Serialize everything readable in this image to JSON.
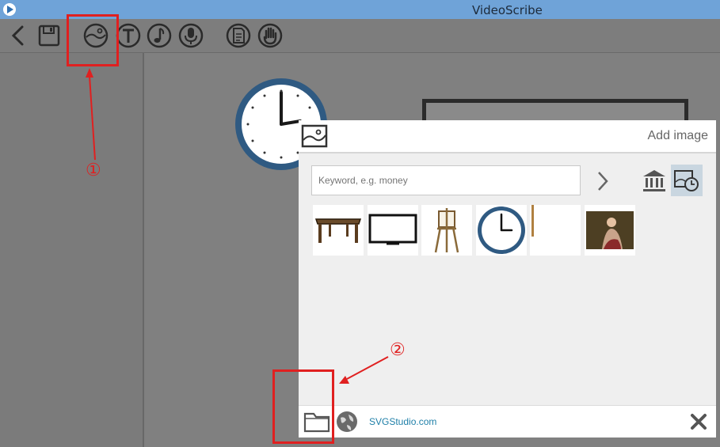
{
  "window": {
    "title": "VideoScribe"
  },
  "toolbar": {
    "buttons": [
      {
        "name": "back-icon"
      },
      {
        "name": "save-icon"
      },
      {
        "name": "image-icon"
      },
      {
        "name": "text-icon"
      },
      {
        "name": "music-icon"
      },
      {
        "name": "microphone-icon"
      },
      {
        "name": "document-icon"
      },
      {
        "name": "hand-icon"
      }
    ]
  },
  "add_image_panel": {
    "title": "Add image",
    "search": {
      "value": "",
      "placeholder": "Keyword, e.g. money"
    },
    "thumbnails": [
      {
        "name": "table-thumbnail"
      },
      {
        "name": "monitor-thumbnail"
      },
      {
        "name": "easel-thumbnail"
      },
      {
        "name": "clock-thumbnail"
      },
      {
        "name": "stick-thumbnail"
      },
      {
        "name": "painting-thumbnail"
      }
    ],
    "footer": {
      "link_text": "SVGStudio.com"
    }
  },
  "annotations": {
    "label_1": "①",
    "label_2": "②"
  },
  "colors": {
    "titlebar": "#6fa3d8",
    "annotation": "#e02020",
    "link": "#1e7fa8"
  }
}
